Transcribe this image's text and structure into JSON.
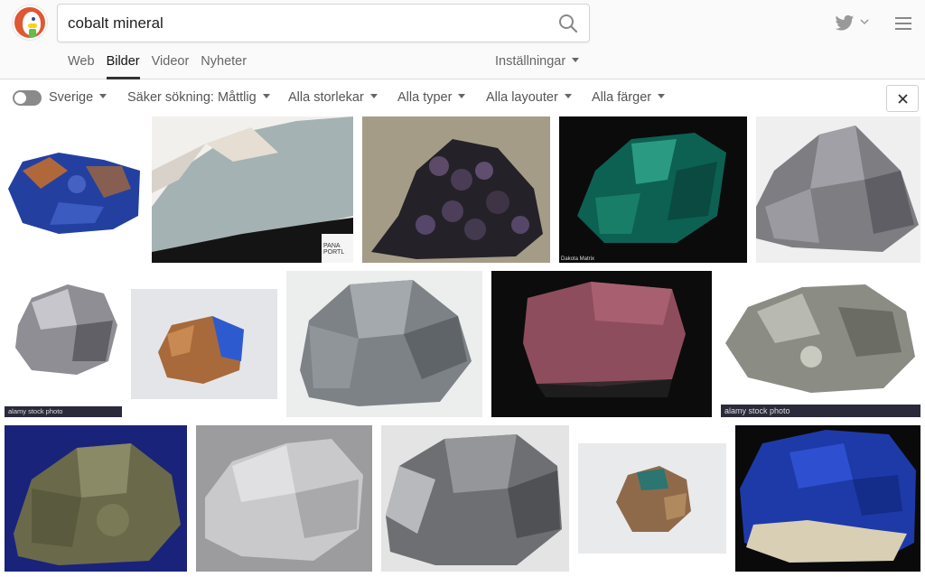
{
  "search": {
    "query": "cobalt mineral"
  },
  "nav": {
    "tabs": [
      "Web",
      "Bilder",
      "Videor",
      "Nyheter"
    ],
    "active": "Bilder",
    "settings_label": "Inställningar"
  },
  "filters": {
    "region_label": "Sverige",
    "safe_search": "Säker sökning: Måttlig",
    "size": "Alla storlekar",
    "type": "Alla typer",
    "layout": "Alla layouter",
    "color": "Alla färger"
  },
  "tiles": [
    {
      "id": "img-1",
      "caption": ""
    },
    {
      "id": "img-2",
      "caption": "PANA PORTL"
    },
    {
      "id": "img-3",
      "caption": ""
    },
    {
      "id": "img-4",
      "caption": "Dakota Matrix"
    },
    {
      "id": "img-5",
      "caption": ""
    },
    {
      "id": "img-6",
      "caption": "alamy stock photo"
    },
    {
      "id": "img-7",
      "caption": ""
    },
    {
      "id": "img-8",
      "caption": ""
    },
    {
      "id": "img-9",
      "caption": ""
    },
    {
      "id": "img-10",
      "caption": "alamy stock photo"
    },
    {
      "id": "img-11",
      "caption": ""
    },
    {
      "id": "img-12",
      "caption": ""
    },
    {
      "id": "img-13",
      "caption": ""
    },
    {
      "id": "img-14",
      "caption": ""
    },
    {
      "id": "img-15",
      "caption": ""
    }
  ],
  "colors": {
    "brand": "#de5833",
    "toggle": "#8a8a8a"
  },
  "icons": [
    "duckduckgo-logo",
    "search-icon",
    "twitter-icon",
    "chevron-down-icon",
    "hamburger-menu-icon",
    "close-icon"
  ]
}
